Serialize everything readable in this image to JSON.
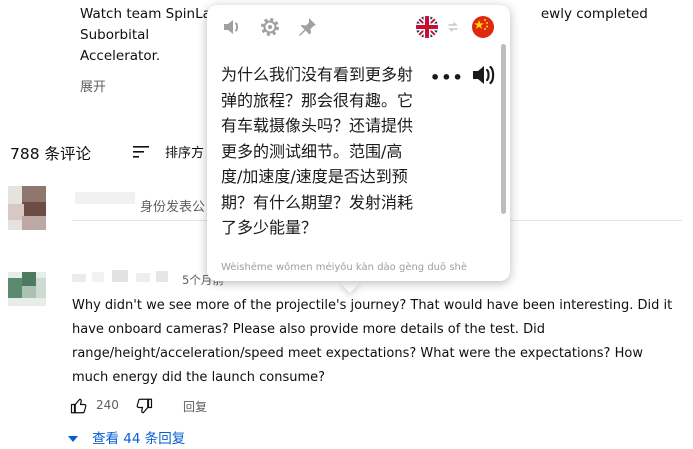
{
  "video": {
    "description_line1_start": "Watch team SpinLa",
    "description_line1_end": "ewly completed Suborbital",
    "description_line2": "Accelerator.",
    "expand_label": "展开"
  },
  "comments_header": {
    "count_label": "788 条评论",
    "sort_label": "排序方"
  },
  "comment_input": {
    "placeholder": "身份发表公"
  },
  "comment": {
    "time": "5个月前",
    "text": "Why didn't we see more of the projectile's journey? That would have been interesting. Did it have onboard cameras? Please also provide more details of the test. Did range/height/acceleration/speed meet expectations? What were the expectations? How much energy did the launch consume?",
    "likes": "240",
    "reply_label": "回复",
    "view_replies": "查看 44 条回复"
  },
  "translator_popup": {
    "translation": "为什么我们没有看到更多射弹的旅程？那会很有趣。它有车载摄像头吗？还请提供更多的测试细节。范围/高度/加速度/速度是否达到预期？有什么期望？发射消耗了多少能量？",
    "more_label": "•••",
    "pinyin": "Wèishéme wǒmen méiyǒu kàn dào gèng duō shè",
    "source_language_icon": "uk-flag-icon",
    "target_language_icon": "china-flag-icon"
  },
  "colors": {
    "link_blue": "#065fd4",
    "secondary_text": "#606060",
    "china_red": "#de2910",
    "china_star": "#ffde00",
    "uk_blue": "#012169",
    "uk_red": "#c8102e"
  }
}
